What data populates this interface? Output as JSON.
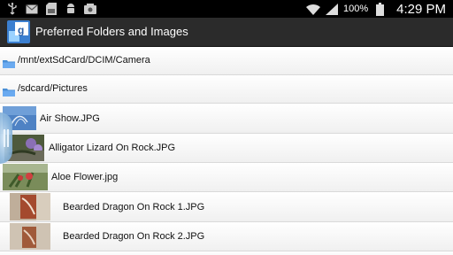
{
  "status_bar": {
    "battery": "100%",
    "time": "4:29 PM",
    "icons": [
      "usb-icon",
      "email-icon",
      "sd-card-icon",
      "android-icon",
      "sd-card-icon",
      "wifi-icon",
      "signal-icon",
      "battery-icon"
    ]
  },
  "title_bar": {
    "title": "Preferred Folders and Images",
    "icon": "app-icon"
  },
  "folders": [
    {
      "path": "/mnt/extSdCard/DCIM/Camera"
    },
    {
      "path": "/sdcard/Pictures"
    }
  ],
  "images": [
    {
      "name": "Air Show.JPG"
    },
    {
      "name": "Alligator Lizard On Rock.JPG"
    },
    {
      "name": "Aloe Flower.jpg"
    },
    {
      "name": "Bearded Dragon On Rock 1.JPG"
    },
    {
      "name": "Bearded Dragon On Rock 2.JPG"
    }
  ],
  "colors": {
    "titlebar": "#2b2b2b",
    "folder": "#4a8fd6",
    "scroll_handle": "#8db8de"
  }
}
